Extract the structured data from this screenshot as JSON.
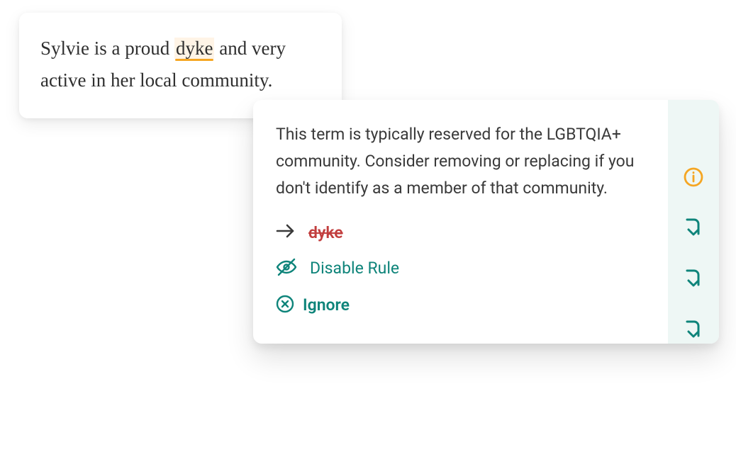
{
  "editor": {
    "text_before": "Sylvie is a proud ",
    "flagged_word": "dyke",
    "text_after": " and very active in her local community."
  },
  "suggestion": {
    "description": "This term is typically reserved for the LGBTQIA+ community. Consider removing or replacing if you don't identify as a member of that community.",
    "replacement_term": "dyke",
    "disable_rule_label": "Disable Rule",
    "ignore_label": "Ignore"
  },
  "colors": {
    "teal": "#0e847a",
    "orange": "#f5a623",
    "red": "#c23e3e"
  }
}
